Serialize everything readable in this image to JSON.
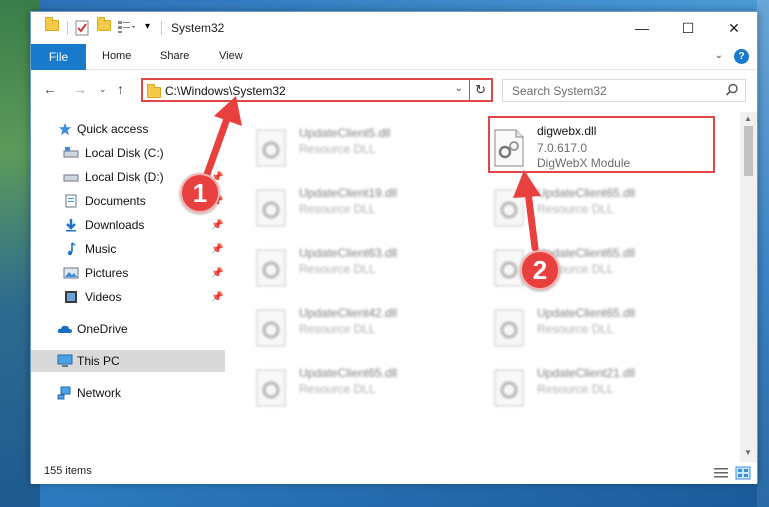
{
  "window": {
    "title": "System32",
    "controls": {
      "minimize": "—",
      "maximize": "☐",
      "close": "✕"
    }
  },
  "ribbon": {
    "tabs": [
      "File",
      "Home",
      "Share",
      "View"
    ],
    "help": "?"
  },
  "address": {
    "path": "C:\\Windows\\System32"
  },
  "search": {
    "placeholder": "Search System32"
  },
  "sidebar": {
    "items": [
      {
        "label": "Quick access",
        "icon": "star-icon"
      },
      {
        "label": "Local Disk (C:)",
        "icon": "drive-icon"
      },
      {
        "label": "Local Disk (D:)",
        "icon": "drive-icon"
      },
      {
        "label": "Documents",
        "icon": "documents-icon"
      },
      {
        "label": "Downloads",
        "icon": "download-icon"
      },
      {
        "label": "Music",
        "icon": "music-icon"
      },
      {
        "label": "Pictures",
        "icon": "pictures-icon"
      },
      {
        "label": "Videos",
        "icon": "videos-icon"
      },
      {
        "label": "OneDrive",
        "icon": "cloud-icon"
      },
      {
        "label": "This PC",
        "icon": "computer-icon"
      },
      {
        "label": "Network",
        "icon": "network-icon"
      }
    ]
  },
  "files": {
    "left": [
      {
        "name": "UpdateClient5.dll",
        "type": "Resource DLL"
      },
      {
        "name": "UpdateClient19.dll",
        "type": "Resource DLL"
      },
      {
        "name": "UpdateClient63.dll",
        "type": "Resource DLL"
      },
      {
        "name": "UpdateClient42.dll",
        "type": "Resource DLL"
      },
      {
        "name": "UpdateClient65.dll",
        "type": "Resource DLL"
      }
    ],
    "right": [
      {
        "name": "UpdateClient65.dll",
        "type": "Resource DLL"
      },
      {
        "name": "UpdateClient65.dll",
        "type": "Resource DLL"
      },
      {
        "name": "UpdateClient65.dll",
        "type": "Resource DLL"
      },
      {
        "name": "UpdateClient21.dll",
        "type": "Resource DLL"
      }
    ],
    "highlighted": {
      "name": "digwebx.dll",
      "version": "7.0.617.0",
      "description": "DigWebX Module"
    }
  },
  "status": {
    "items": "155 items"
  },
  "annotations": {
    "badge1": "1",
    "badge2": "2",
    "color": "#e8403f"
  }
}
